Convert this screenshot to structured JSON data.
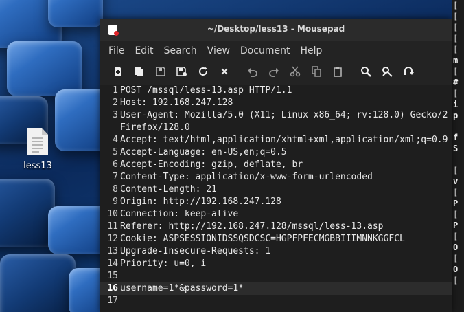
{
  "desktop": {
    "icon_label": "less13"
  },
  "window": {
    "title": "~/Desktop/less13 - Mousepad",
    "menu": [
      "File",
      "Edit",
      "Search",
      "View",
      "Document",
      "Help"
    ],
    "toolbar": [
      {
        "name": "new-document-icon"
      },
      {
        "name": "new-window-icon"
      },
      {
        "name": "save-icon"
      },
      {
        "name": "save-as-icon"
      },
      {
        "name": "reload-icon"
      },
      {
        "name": "close-document-icon"
      },
      {
        "name": "undo-icon"
      },
      {
        "name": "redo-icon"
      },
      {
        "name": "cut-icon"
      },
      {
        "name": "copy-icon"
      },
      {
        "name": "paste-icon"
      },
      {
        "name": "find-icon"
      },
      {
        "name": "find-replace-icon"
      },
      {
        "name": "go-to-line-icon"
      }
    ]
  },
  "editor": {
    "current_line": 16,
    "lines": [
      {
        "num": "1",
        "text": "POST /mssql/less-13.asp HTTP/1.1"
      },
      {
        "num": "2",
        "text": "Host: 192.168.247.128"
      },
      {
        "num": "3",
        "text": "User-Agent: Mozilla/5.0 (X11; Linux x86_64; rv:128.0) Gecko/2"
      },
      {
        "num": "",
        "text": "Firefox/128.0"
      },
      {
        "num": "4",
        "text": "Accept: text/html,application/xhtml+xml,application/xml;q=0.9"
      },
      {
        "num": "5",
        "text": "Accept-Language: en-US,en;q=0.5"
      },
      {
        "num": "6",
        "text": "Accept-Encoding: gzip, deflate, br"
      },
      {
        "num": "7",
        "text": "Content-Type: application/x-www-form-urlencoded"
      },
      {
        "num": "8",
        "text": "Content-Length: 21"
      },
      {
        "num": "9",
        "text": "Origin: http://192.168.247.128"
      },
      {
        "num": "10",
        "text": "Connection: keep-alive"
      },
      {
        "num": "11",
        "text": "Referer: http://192.168.247.128/mssql/less-13.asp"
      },
      {
        "num": "12",
        "text": "Cookie: ASPSESSIONIDSSQSDCSC=HGPFPFECMGBBIIIMNNKGGFCL"
      },
      {
        "num": "13",
        "text": "Upgrade-Insecure-Requests: 1"
      },
      {
        "num": "14",
        "text": "Priority: u=0, i"
      },
      {
        "num": "15",
        "text": ""
      },
      {
        "num": "16",
        "text": "username=1*&password=1*"
      },
      {
        "num": "17",
        "text": ""
      }
    ]
  },
  "terminal": {
    "lines": [
      "[",
      "[",
      "[",
      "[",
      "[",
      "m",
      "[",
      "#",
      "[",
      "i",
      "p",
      "",
      "f",
      "S",
      "",
      "[",
      "v",
      "[",
      "P",
      "[",
      "P",
      "[",
      "O",
      "[",
      "O",
      "["
    ]
  }
}
